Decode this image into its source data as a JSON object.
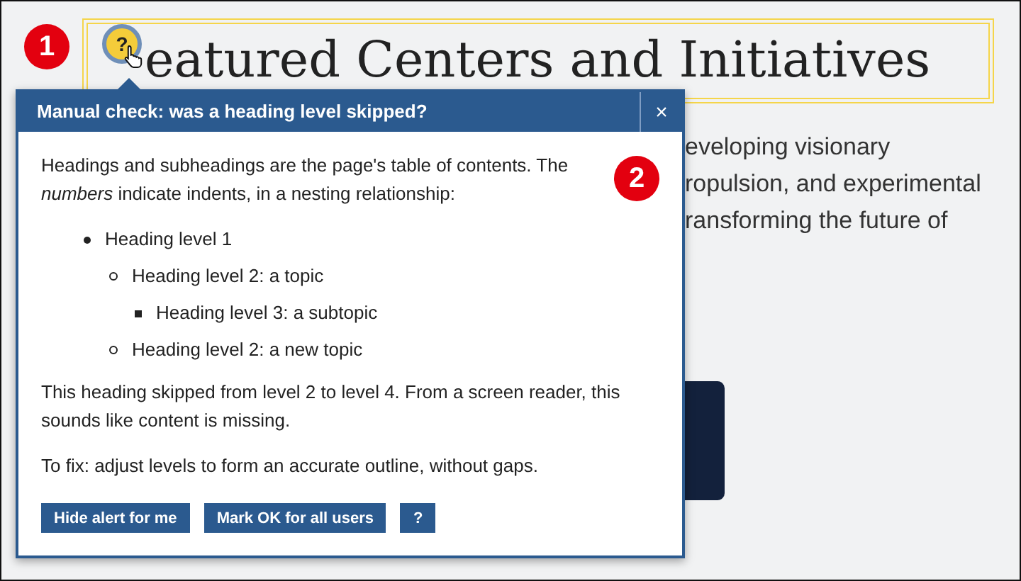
{
  "heading": {
    "text": "eatured Centers and Initiatives",
    "badge": "?"
  },
  "background_text": [
    "eveloping visionary",
    "ropulsion, and experimental",
    "ransforming the future of"
  ],
  "markers": [
    "1",
    "2"
  ],
  "popup": {
    "title": "Manual check: was a heading level skipped?",
    "close": "×",
    "intro": "Headings and subheadings are the page's table of contents. The *numbers* indicate indents, in a nesting relationship:",
    "outline": [
      {
        "text": "Heading level 1",
        "children": [
          {
            "text": "Heading level 2: a topic",
            "children": [
              {
                "text": "Heading level 3: a subtopic"
              }
            ]
          },
          {
            "text": "Heading level 2: a new topic"
          }
        ]
      }
    ],
    "paragraphs": [
      "This heading skipped from level 2 to level 4. From a screen reader, this sounds like content is missing.",
      "To fix: adjust levels to form an accurate outline, without gaps."
    ],
    "buttons": [
      "Hide alert for me",
      "Mark OK for all users",
      "?"
    ]
  }
}
